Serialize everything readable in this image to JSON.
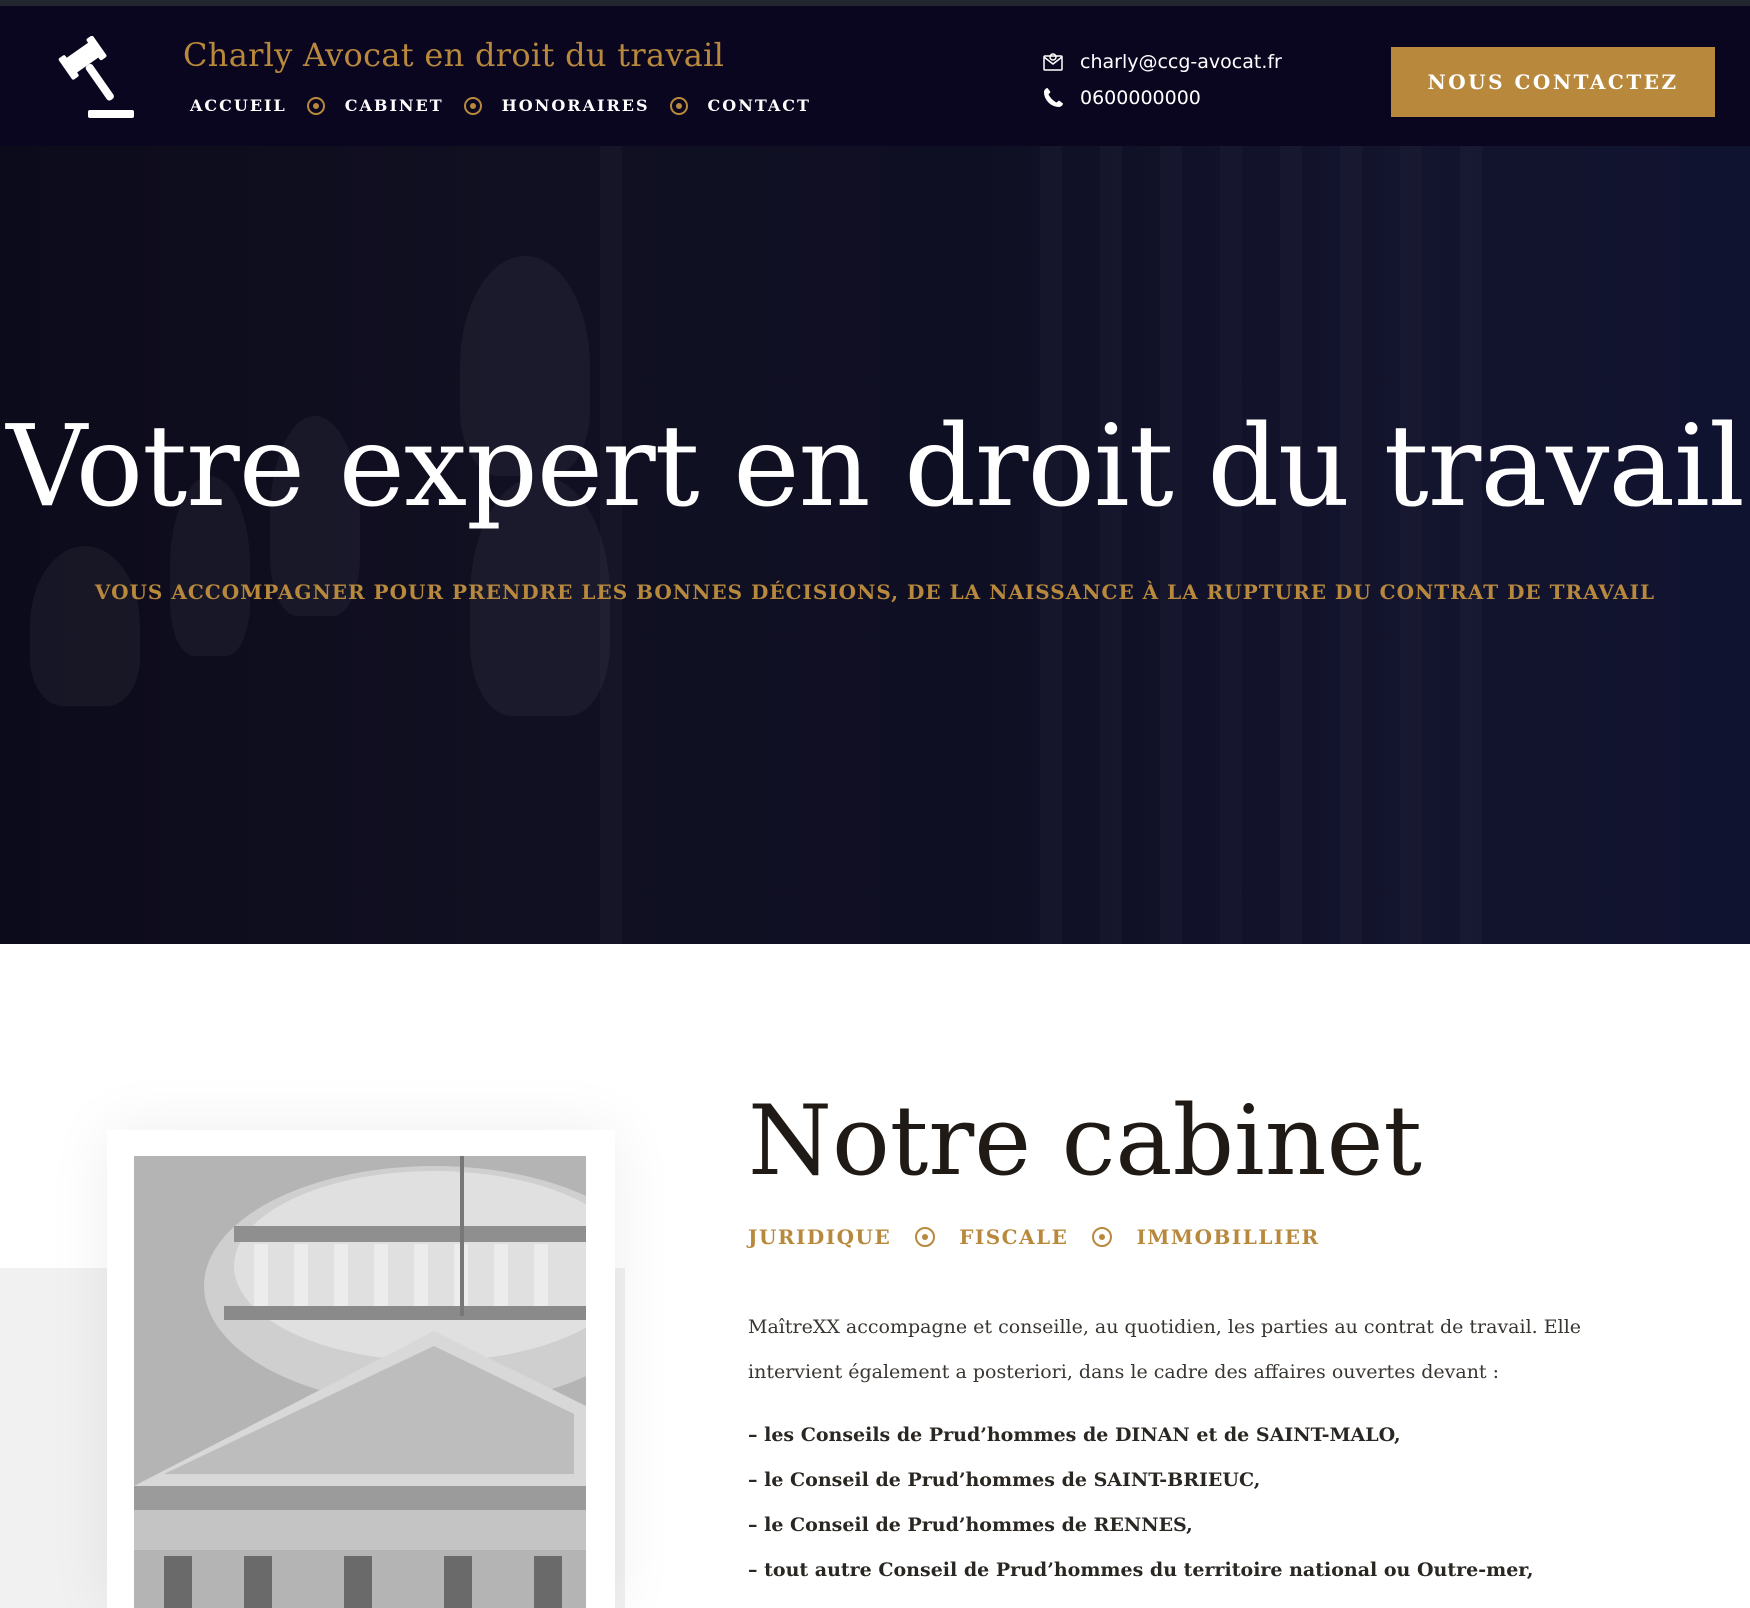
{
  "header": {
    "brand": "Charly Avocat en droit du travail",
    "nav": [
      "ACCUEIL",
      "CABINET",
      "HONORAIRES",
      "CONTACT"
    ],
    "email": "charly@ccg-avocat.fr",
    "phone": "0600000000",
    "cta_label": "NOUS CONTACTEZ"
  },
  "hero": {
    "title": "Votre expert en droit du travail",
    "subtitle": "VOUS ACCOMPAGNER POUR PRENDRE LES BONNES DÉCISIONS, DE LA NAISSANCE À LA RUPTURE DU CONTRAT DE TRAVAIL"
  },
  "cabinet": {
    "title": "Notre cabinet",
    "categories": [
      "JURIDIQUE",
      "FISCALE",
      "IMMOBILLIER"
    ],
    "intro": "MaîtreXX accompagne et conseille, au quotidien, les parties au contrat de travail. Elle intervient également a posteriori, dans le cadre des affaires ouvertes devant :",
    "items": [
      "– les Conseils de Prud’hommes de DINAN et de SAINT-MALO,",
      "– le Conseil de Prud’hommes de SAINT-BRIEUC,",
      "– le Conseil de Prud’hommes de RENNES,",
      "– tout autre Conseil de Prud’hommes du territoire national ou Outre-mer,"
    ]
  },
  "icons": {
    "logo": "gavel-icon",
    "email": "envelope-icon",
    "phone": "phone-icon",
    "separator": "target-dot-icon"
  },
  "colors": {
    "header_bg": "#0b0620",
    "accent_gold": "#b8893c",
    "hero_bg": "#111022",
    "title_text": "#1f1a15"
  }
}
